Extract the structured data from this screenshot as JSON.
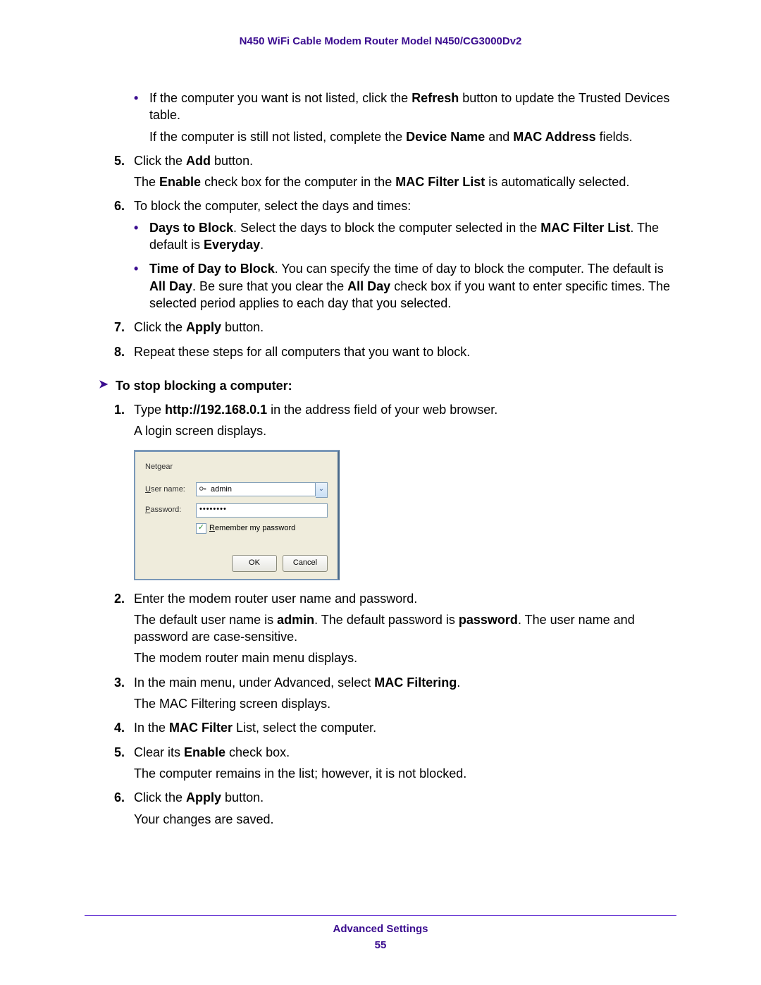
{
  "header": {
    "title": "N450 WiFi Cable Modem Router Model N450/CG3000Dv2"
  },
  "bullet1": {
    "pre": "If the computer you want is not listed, click the ",
    "b1": "Refresh",
    "post": " button to update the Trusted Devices table."
  },
  "bullet1_sub": {
    "pre": "If the computer is still not listed, complete the ",
    "b1": "Device Name",
    "mid": " and ",
    "b2": "MAC Address",
    "post": " fields."
  },
  "step5a": {
    "pre": "Click the ",
    "b1": "Add",
    "post": " button."
  },
  "step5a_sub": {
    "pre": "The ",
    "b1": "Enable",
    "mid1": " check box for the computer in the ",
    "b2": "MAC Filter List",
    "post": " is automatically selected."
  },
  "step6a": {
    "text": "To block the computer, select the days and times:"
  },
  "sub_days": {
    "b1": "Days to Block",
    "mid": ". Select the days to block the computer selected in the ",
    "b2": "MAC Filter List",
    "post1": ". The default is ",
    "b3": "Everyday",
    "post2": "."
  },
  "sub_time": {
    "b1": "Time of Day to Block",
    "mid1": ". You can specify the time of day to block the computer. The default is ",
    "b2": "All Day",
    "mid2": ". Be sure that you clear the ",
    "b3": "All Day",
    "post": " check box if you want to enter specific times. The selected period applies to each day that you selected."
  },
  "step7a": {
    "pre": "Click the ",
    "b1": "Apply",
    "post": " button."
  },
  "step8a": {
    "text": "Repeat these steps for all computers that you want to block."
  },
  "proc_heading": "To stop blocking a computer:",
  "b_step1": {
    "pre": "Type ",
    "b1": "http://192.168.0.1",
    "post": " in the address field of your web browser.",
    "line2": "A login screen displays."
  },
  "login": {
    "brand": "Netgear",
    "user_label": "User name:",
    "pass_label": "Password:",
    "user_value": "admin",
    "pass_mask": "••••••••",
    "remember": "Remember my password",
    "ok": "OK",
    "cancel": "Cancel"
  },
  "b_step2": {
    "line1": "Enter the modem router user name and password.",
    "l2_pre": "The default user name is ",
    "l2_b1": "admin",
    "l2_mid": ". The default password is ",
    "l2_b2": "password",
    "l2_post": ". The user name and password are case-sensitive.",
    "line3": "The modem router main menu displays."
  },
  "b_step3": {
    "l1_pre": "In the main menu, under Advanced, select ",
    "l1_b1": "MAC Filtering",
    "l1_post": ".",
    "line2": "The MAC Filtering screen displays."
  },
  "b_step4": {
    "pre": "In the ",
    "b1": "MAC Filter",
    "post": " List, select the computer."
  },
  "b_step5": {
    "l1_pre": "Clear its ",
    "l1_b1": "Enable",
    "l1_post": " check box.",
    "line2": "The computer remains in the list; however, it is not blocked."
  },
  "b_step6": {
    "l1_pre": "Click the ",
    "l1_b1": "Apply",
    "l1_post": " button.",
    "line2": "Your changes are saved."
  },
  "nums": {
    "n1": "1.",
    "n2": "2.",
    "n3": "3.",
    "n4": "4.",
    "n5": "5.",
    "n6": "6.",
    "n7": "7.",
    "n8": "8."
  },
  "footer": {
    "section": "Advanced Settings",
    "page": "55"
  }
}
